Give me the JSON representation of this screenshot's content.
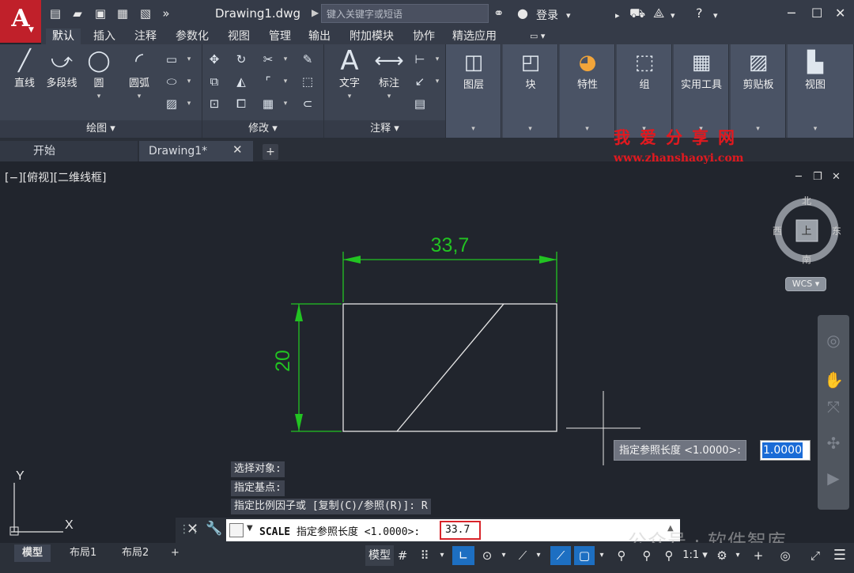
{
  "titlebar": {
    "logo": "A",
    "doc_title": "Drawing1.dwg",
    "search_placeholder": "键入关键字或短语",
    "login": "登录"
  },
  "ribbon_tabs": [
    "默认",
    "插入",
    "注释",
    "参数化",
    "视图",
    "管理",
    "输出",
    "附加模块",
    "协作",
    "精选应用"
  ],
  "ribbon": {
    "draw": {
      "line": "直线",
      "polyline": "多段线",
      "circle": "圆",
      "arc": "圆弧",
      "footer": "绘图 ▾"
    },
    "modify": {
      "footer": "修改 ▾"
    },
    "annotation": {
      "text": "文字",
      "dimension": "标注",
      "footer": "注释 ▾"
    },
    "layers": "图层",
    "block": "块",
    "properties": "特性",
    "group": "组",
    "utilities": "实用工具",
    "clipboard": "剪贴板",
    "view": "视图"
  },
  "file_tabs": {
    "start": "开始",
    "drawing": "Drawing1*"
  },
  "viewport": {
    "label": "[−][俯视][二维线框]"
  },
  "viewcube": {
    "north": "北",
    "south": "南",
    "east": "东",
    "west": "西",
    "top": "上",
    "wcs": "WCS ▾"
  },
  "drawing": {
    "dim_horizontal": "33,7",
    "dim_vertical": "20"
  },
  "ucs": {
    "x": "X",
    "y": "Y"
  },
  "watermark": {
    "cn": "我爱分享网",
    "url": "www.zhanshaoyi.com",
    "gz": "公众号 · 软件智库"
  },
  "tooltip": {
    "prompt": "指定参照长度 <1.0000>:",
    "value": "1.0000"
  },
  "history": [
    "选择对象:",
    "指定基点:",
    "指定比例因子或 [复制(C)/参照(R)]: R"
  ],
  "command": {
    "name": "SCALE",
    "prompt": " 指定参照长度 <1.0000>:",
    "value": "33.7"
  },
  "status": {
    "tabs": [
      "模型",
      "布局1",
      "布局2"
    ],
    "add": "+",
    "model_label": "模型",
    "scale": "1:1 ▾"
  }
}
